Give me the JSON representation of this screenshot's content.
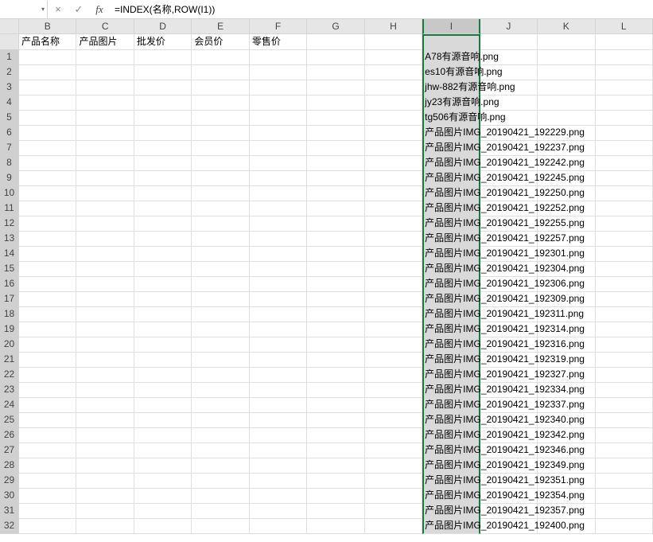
{
  "formula_bar": {
    "name_box": "",
    "cancel": "×",
    "accept": "✓",
    "fx": "fx",
    "formula": "=INDEX(名称,ROW(I1))"
  },
  "columns": [
    "B",
    "C",
    "D",
    "E",
    "F",
    "G",
    "H",
    "I",
    "J",
    "K",
    "L"
  ],
  "header_row": {
    "B": "产品名称",
    "C": "产品图片",
    "D": "批发价",
    "E": "会员价",
    "F": "零售价"
  },
  "rows": [
    {
      "n": 1,
      "i": "A78有源音响.png"
    },
    {
      "n": 2,
      "i": "es10有源音响.png"
    },
    {
      "n": 3,
      "i": "jhw-882有源音响.png"
    },
    {
      "n": 4,
      "i": "jy23有源音响.png"
    },
    {
      "n": 5,
      "i": "tg506有源音响.png"
    },
    {
      "n": 6,
      "i": "产品图片IMG_20190421_192229.png"
    },
    {
      "n": 7,
      "i": "产品图片IMG_20190421_192237.png"
    },
    {
      "n": 8,
      "i": "产品图片IMG_20190421_192242.png"
    },
    {
      "n": 9,
      "i": "产品图片IMG_20190421_192245.png"
    },
    {
      "n": 10,
      "i": "产品图片IMG_20190421_192250.png"
    },
    {
      "n": 11,
      "i": "产品图片IMG_20190421_192252.png"
    },
    {
      "n": 12,
      "i": "产品图片IMG_20190421_192255.png"
    },
    {
      "n": 13,
      "i": "产品图片IMG_20190421_192257.png"
    },
    {
      "n": 14,
      "i": "产品图片IMG_20190421_192301.png"
    },
    {
      "n": 15,
      "i": "产品图片IMG_20190421_192304.png"
    },
    {
      "n": 16,
      "i": "产品图片IMG_20190421_192306.png"
    },
    {
      "n": 17,
      "i": "产品图片IMG_20190421_192309.png"
    },
    {
      "n": 18,
      "i": "产品图片IMG_20190421_192311.png"
    },
    {
      "n": 19,
      "i": "产品图片IMG_20190421_192314.png"
    },
    {
      "n": 20,
      "i": "产品图片IMG_20190421_192316.png"
    },
    {
      "n": 21,
      "i": "产品图片IMG_20190421_192319.png"
    },
    {
      "n": 22,
      "i": "产品图片IMG_20190421_192327.png"
    },
    {
      "n": 23,
      "i": "产品图片IMG_20190421_192334.png"
    },
    {
      "n": 24,
      "i": "产品图片IMG_20190421_192337.png"
    },
    {
      "n": 25,
      "i": "产品图片IMG_20190421_192340.png"
    },
    {
      "n": 26,
      "i": "产品图片IMG_20190421_192342.png"
    },
    {
      "n": 27,
      "i": "产品图片IMG_20190421_192346.png"
    },
    {
      "n": 28,
      "i": "产品图片IMG_20190421_192349.png"
    },
    {
      "n": 29,
      "i": "产品图片IMG_20190421_192351.png"
    },
    {
      "n": 30,
      "i": "产品图片IMG_20190421_192354.png"
    },
    {
      "n": 31,
      "i": "产品图片IMG_20190421_192357.png"
    },
    {
      "n": 32,
      "i": "产品图片IMG_20190421_192400.png"
    }
  ]
}
